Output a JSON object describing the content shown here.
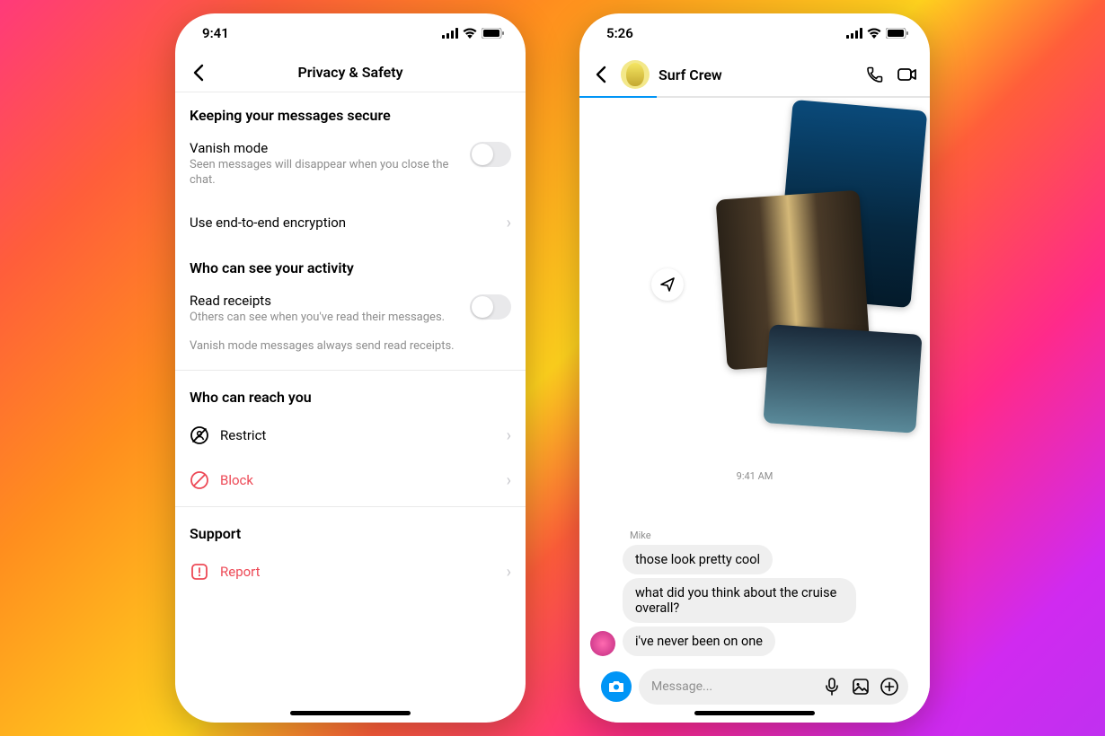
{
  "phone1": {
    "status_time": "9:41",
    "nav_title": "Privacy & Safety",
    "section1_title": "Keeping your messages secure",
    "vanish": {
      "label": "Vanish mode",
      "sub": "Seen messages will disappear when you close the chat."
    },
    "e2e": {
      "label": "Use end-to-end encryption"
    },
    "section2_title": "Who can see your activity",
    "read_receipts": {
      "label": "Read receipts",
      "sub": "Others can see when you've read their messages."
    },
    "read_receipts_note": "Vanish mode messages always send read receipts.",
    "section3_title": "Who can reach you",
    "restrict": {
      "label": "Restrict"
    },
    "block": {
      "label": "Block"
    },
    "section4_title": "Support",
    "report": {
      "label": "Report"
    }
  },
  "phone2": {
    "status_time": "5:26",
    "chat_title": "Surf Crew",
    "timestamp": "9:41 AM",
    "sender": "Mike",
    "msgs": {
      "m1": "those look pretty cool",
      "m2": "what did you think about the cruise overall?",
      "m3": "i've never been on one"
    },
    "composer_placeholder": "Message..."
  }
}
